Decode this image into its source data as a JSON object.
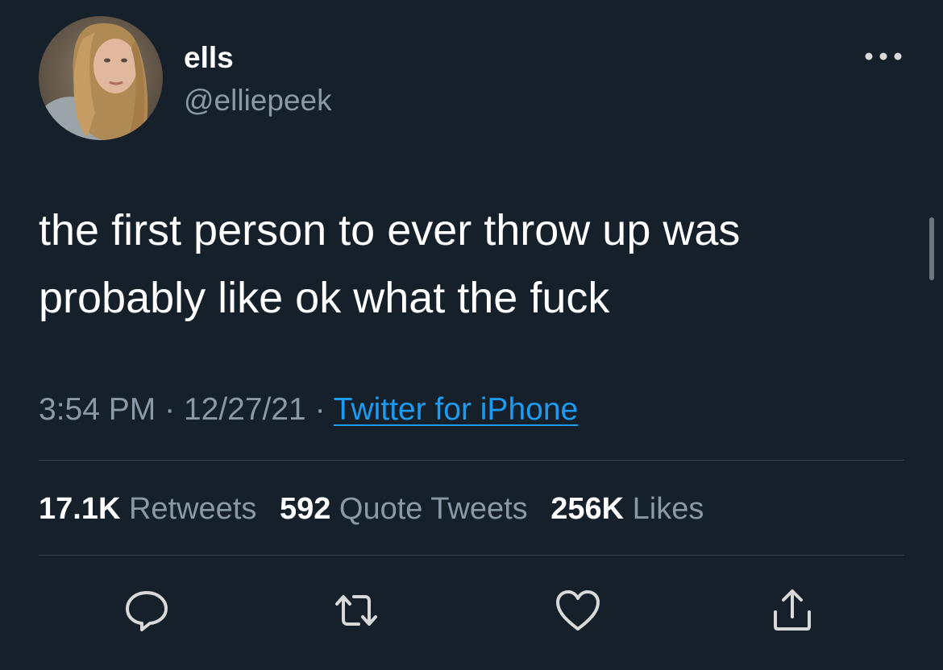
{
  "tweet": {
    "author": {
      "display_name": "ells",
      "handle": "@elliepeek",
      "avatar_icon": "profile-photo"
    },
    "more_icon": "more-horizontal-icon",
    "text_lines": [
      "the first person to ever throw up was",
      "probably like ok what the fuck"
    ],
    "meta": {
      "time": "3:54 PM",
      "separator": "·",
      "date": "12/27/21",
      "source": "Twitter for iPhone"
    },
    "stats": {
      "retweets": {
        "count": "17.1K",
        "label": "Retweets"
      },
      "quote_tweets": {
        "count": "592",
        "label": "Quote Tweets"
      },
      "likes": {
        "count": "256K",
        "label": "Likes"
      }
    },
    "actions": [
      "reply-icon",
      "retweet-icon",
      "like-icon",
      "share-icon"
    ]
  },
  "colors": {
    "background": "#15202b",
    "primary_text": "#ffffff",
    "secondary_text": "#8b98a5",
    "link": "#1d9bf0",
    "divider": "#38444d"
  }
}
